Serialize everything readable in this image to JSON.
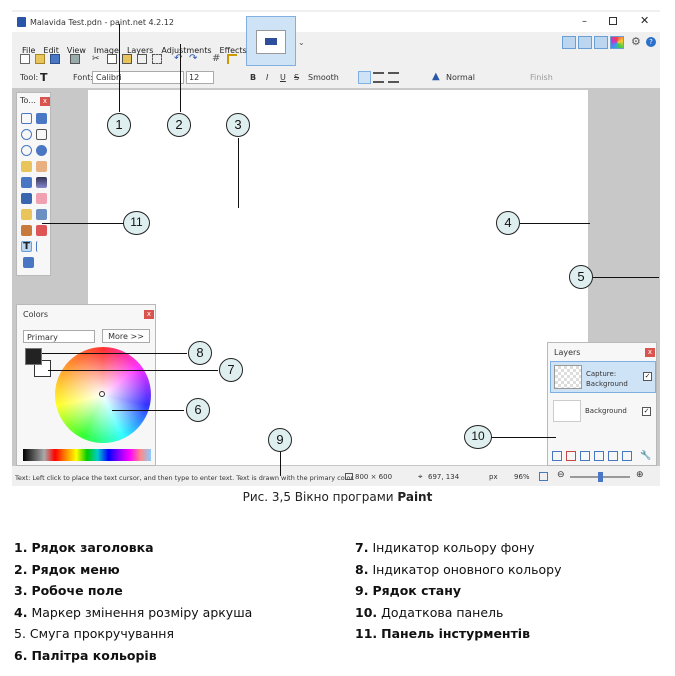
{
  "window": {
    "title": "Malavida Test.pdn - paint.net 4.2.12"
  },
  "menu": [
    "File",
    "Edit",
    "View",
    "Image",
    "Layers",
    "Adjustments",
    "Effects"
  ],
  "toolbar2": {
    "tool_label": "Tool:",
    "font_label": "Font:",
    "font_value": "Calibri",
    "size_value": "12",
    "bold": "B",
    "italic": "I",
    "underline": "U",
    "strike": "S",
    "smooth": "Smooth",
    "blend": "Normal",
    "finish": "Finish"
  },
  "tools_panel": {
    "title": "To..."
  },
  "colors_panel": {
    "title": "Colors",
    "primary_select": "Primary",
    "more_button": "More >>"
  },
  "layers_panel": {
    "title": "Layers",
    "layers": [
      {
        "name": "Capture: Background"
      },
      {
        "name": "Background"
      }
    ]
  },
  "status": {
    "hint": "Text: Left click to place the text cursor, and then type to enter text. Text is drawn with the primary color.",
    "size": "800 × 600",
    "coords": "697, 134",
    "units": "px",
    "zoom": "96%"
  },
  "callouts": [
    "1",
    "2",
    "3",
    "4",
    "5",
    "6",
    "7",
    "8",
    "9",
    "10",
    "11"
  ],
  "caption": {
    "prefix": "Рис. 3,5 Вікно програми ",
    "bold": "Paint"
  },
  "legend_left": [
    {
      "num": "1.",
      "text": "Рядок заголовка",
      "bold": true
    },
    {
      "num": "2.",
      "text": "Рядок меню",
      "bold": true
    },
    {
      "num": "3.",
      "text": "Робоче поле",
      "bold": true
    },
    {
      "num": "4.",
      "text": "Маркер змінення розміру аркуша",
      "bold": false
    },
    {
      "num": "5.",
      "text": "Смуга прокручування",
      "bold": false
    },
    {
      "num": "6.",
      "text": "Палітра кольорів",
      "bold": true
    }
  ],
  "legend_right": [
    {
      "num": "7.",
      "text": "Індикатор кольору фону",
      "bold": false
    },
    {
      "num": "8.",
      "text": "Індикатор оновного кольору",
      "bold": false
    },
    {
      "num": "9.",
      "text": "Рядок стану",
      "bold": true
    },
    {
      "num": "10.",
      "text": "Додаткова панель",
      "bold": false
    },
    {
      "num": "11.",
      "text": "Панель інстурментів",
      "bold": true
    }
  ]
}
